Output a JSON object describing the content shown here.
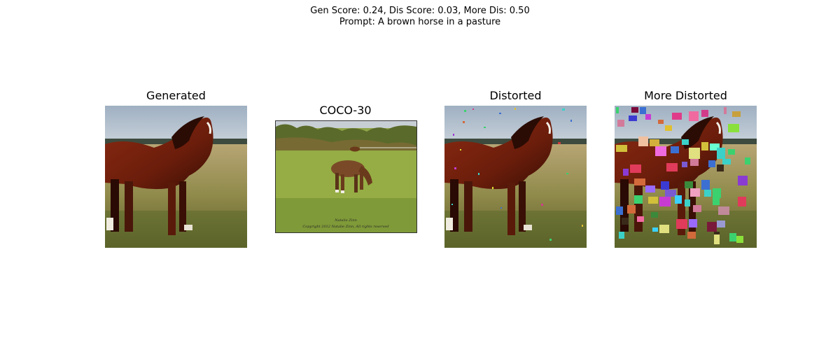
{
  "figure": {
    "suptitle_line1": "Gen Score: 0.24, Dis Score: 0.03, More Dis: 0.50",
    "suptitle_line2": "Prompt: A brown horse in a pasture"
  },
  "panels": [
    {
      "title": "Generated",
      "image": "chestnut horse standing in grassy field, side view"
    },
    {
      "title": "COCO-30",
      "image": "brown horse grazing in green pasture with trees and a second horse in background",
      "watermark_line1": "Natalie Zinn",
      "watermark_line2": "Copyright 2012 Natalie Zinn, All rights reserved"
    },
    {
      "title": "Distorted",
      "image": "same horse image with small colored noise patches"
    },
    {
      "title": "More Distorted",
      "image": "same horse image with many large colored rectangle patches"
    }
  ]
}
